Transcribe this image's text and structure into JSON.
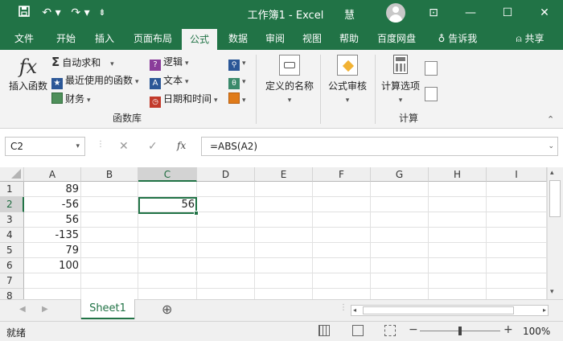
{
  "titlebar": {
    "title": "工作簿1 - Excel",
    "user": "慧",
    "win_ribbon": "⊡",
    "win_min": "—",
    "win_max": "☐",
    "win_close": "✕"
  },
  "tabs": [
    {
      "label": "文件"
    },
    {
      "label": "开始"
    },
    {
      "label": "插入"
    },
    {
      "label": "页面布局"
    },
    {
      "label": "公式"
    },
    {
      "label": "数据"
    },
    {
      "label": "审阅"
    },
    {
      "label": "视图"
    },
    {
      "label": "帮助"
    },
    {
      "label": "百度网盘"
    }
  ],
  "tell_me": "告诉我",
  "share": "共享",
  "ribbon": {
    "insert_function": "插入函数",
    "autosum": "自动求和",
    "recent": "最近使用的函数",
    "financial": "财务",
    "logical": "逻辑",
    "text": "文本",
    "datetime": "日期和时间",
    "group_library": "函数库",
    "defined_names": "定义的名称",
    "formula_auditing": "公式审核",
    "calc_options": "计算选项",
    "group_calc": "计算"
  },
  "formula_bar": {
    "name_box": "C2",
    "fx": "fx",
    "formula": "=ABS(A2)"
  },
  "grid": {
    "columns": [
      "A",
      "B",
      "C",
      "D",
      "E",
      "F",
      "G",
      "H",
      "I"
    ],
    "rows": [
      "1",
      "2",
      "3",
      "4",
      "5",
      "6",
      "7",
      "8"
    ],
    "col_a": [
      "89",
      "-56",
      "56",
      "-135",
      "79",
      "100",
      "",
      ""
    ],
    "c2": "56"
  },
  "sheets": {
    "tab": "Sheet1",
    "add": "⊕"
  },
  "status": {
    "ready": "就绪",
    "zoom": "100%"
  },
  "colors": {
    "accent": "#217346"
  }
}
